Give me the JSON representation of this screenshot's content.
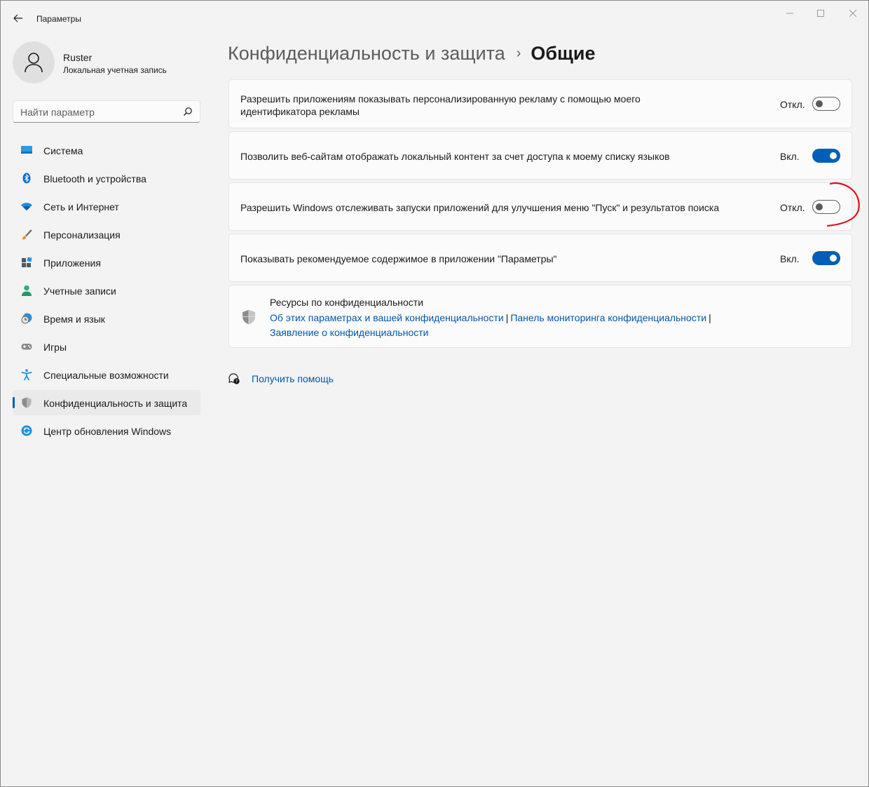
{
  "app": {
    "title": "Параметры"
  },
  "user": {
    "name": "Ruster",
    "account_type": "Локальная учетная запись"
  },
  "search": {
    "placeholder": "Найти параметр"
  },
  "sidebar": {
    "items": [
      {
        "label": "Система",
        "icon": "system-icon"
      },
      {
        "label": "Bluetooth и устройства",
        "icon": "bluetooth-icon"
      },
      {
        "label": "Сеть и Интернет",
        "icon": "wifi-icon"
      },
      {
        "label": "Персонализация",
        "icon": "brush-icon"
      },
      {
        "label": "Приложения",
        "icon": "apps-icon"
      },
      {
        "label": "Учетные записи",
        "icon": "account-icon"
      },
      {
        "label": "Время и язык",
        "icon": "time-language-icon"
      },
      {
        "label": "Игры",
        "icon": "gamepad-icon"
      },
      {
        "label": "Специальные возможности",
        "icon": "accessibility-icon"
      },
      {
        "label": "Конфиденциальность и защита",
        "icon": "privacy-shield-icon",
        "active": true
      },
      {
        "label": "Центр обновления Windows",
        "icon": "update-icon"
      }
    ]
  },
  "header": {
    "breadcrumb_parent": "Конфиденциальность и защита",
    "breadcrumb_separator": "›",
    "title": "Общие"
  },
  "settings": [
    {
      "text": "Разрешить приложениям показывать персонализированную рекламу с помощью моего идентификатора рекламы",
      "state": "Откл.",
      "on": false
    },
    {
      "text": "Позволить веб-сайтам отображать локальный контент за счет доступа к моему списку языков",
      "state": "Вкл.",
      "on": true
    },
    {
      "text": "Разрешить Windows отслеживать запуски приложений для улучшения меню \"Пуск\" и результатов поиска",
      "state": "Откл.",
      "on": false
    },
    {
      "text": "Показывать рекомендуемое содержимое в приложении \"Параметры\"",
      "state": "Вкл.",
      "on": true
    }
  ],
  "resources": {
    "title": "Ресурсы по конфиденциальности",
    "links": [
      "Об этих параметрах и вашей конфиденциальности",
      "Панель мониторинга конфиденциальности",
      "Заявление о конфиденциальности"
    ],
    "separator": "|"
  },
  "help": {
    "label": "Получить помощь"
  },
  "colors": {
    "accent": "#005fb8",
    "link": "#0058a8",
    "annotation": "#e0101e"
  }
}
